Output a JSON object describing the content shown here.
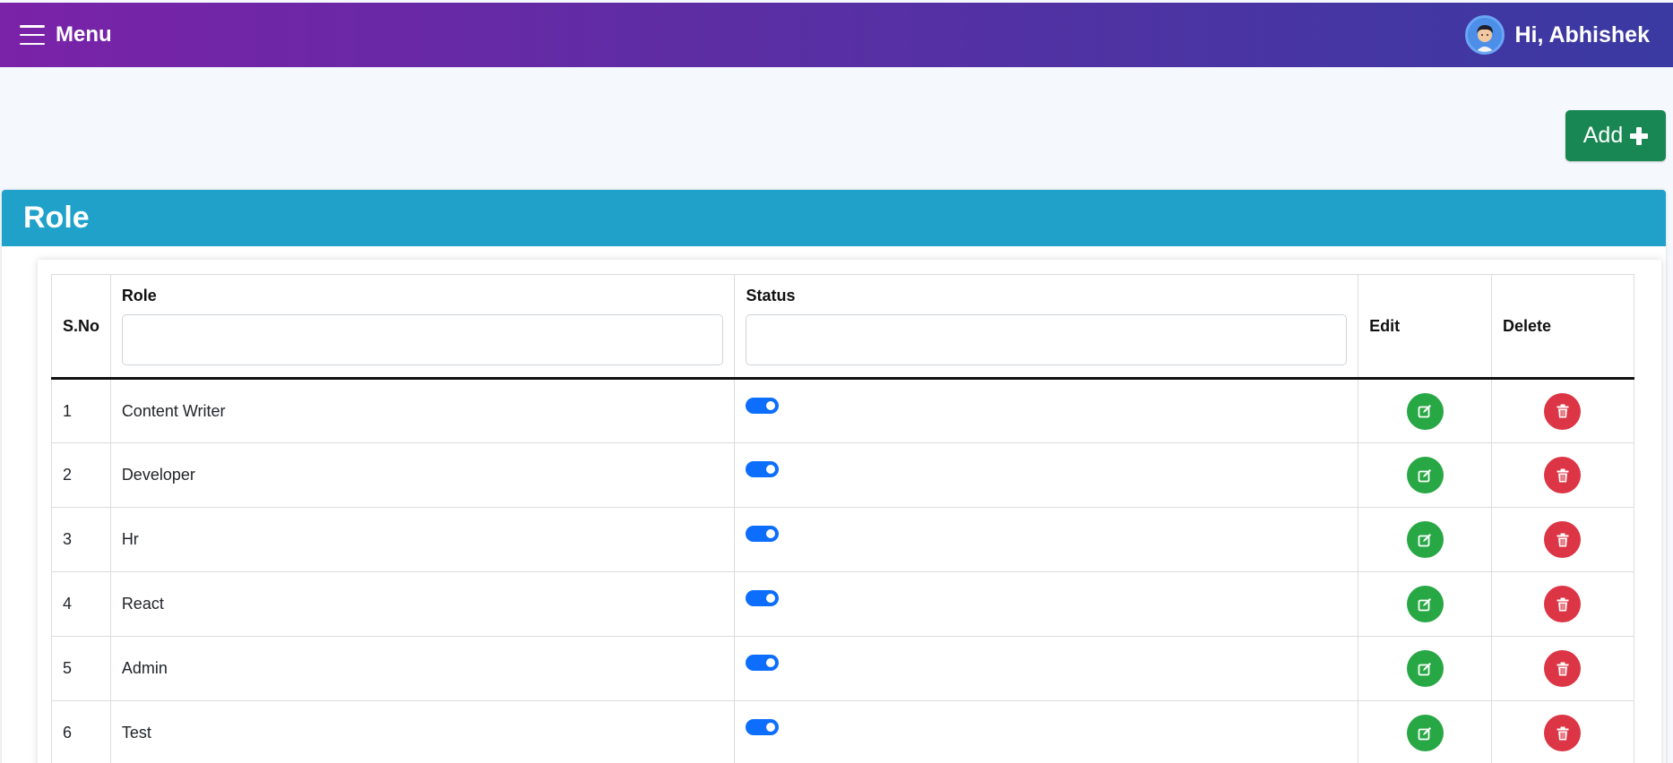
{
  "header": {
    "menu_label": "Menu",
    "greeting": "Hi, Abhishek"
  },
  "toolbar": {
    "add_label": "Add",
    "add_icon": "plus-icon"
  },
  "card": {
    "title": "Role"
  },
  "table": {
    "columns": {
      "sno": "S.No",
      "role": "Role",
      "status": "Status",
      "edit": "Edit",
      "delete": "Delete"
    },
    "filters": {
      "role": "",
      "status": ""
    },
    "rows": [
      {
        "sno": "1",
        "role": "Content Writer",
        "status": true
      },
      {
        "sno": "2",
        "role": "Developer",
        "status": true
      },
      {
        "sno": "3",
        "role": "Hr",
        "status": true
      },
      {
        "sno": "4",
        "role": "React",
        "status": true
      },
      {
        "sno": "5",
        "role": "Admin",
        "status": true
      },
      {
        "sno": "6",
        "role": "Test",
        "status": true
      }
    ]
  },
  "colors": {
    "topbar_start": "#7a22a8",
    "topbar_end": "#3a3aa2",
    "card_header": "#1fa1ca",
    "add_button": "#198754",
    "toggle_on": "#0d6efd",
    "edit_button": "#28a745",
    "delete_button": "#dc3545"
  }
}
